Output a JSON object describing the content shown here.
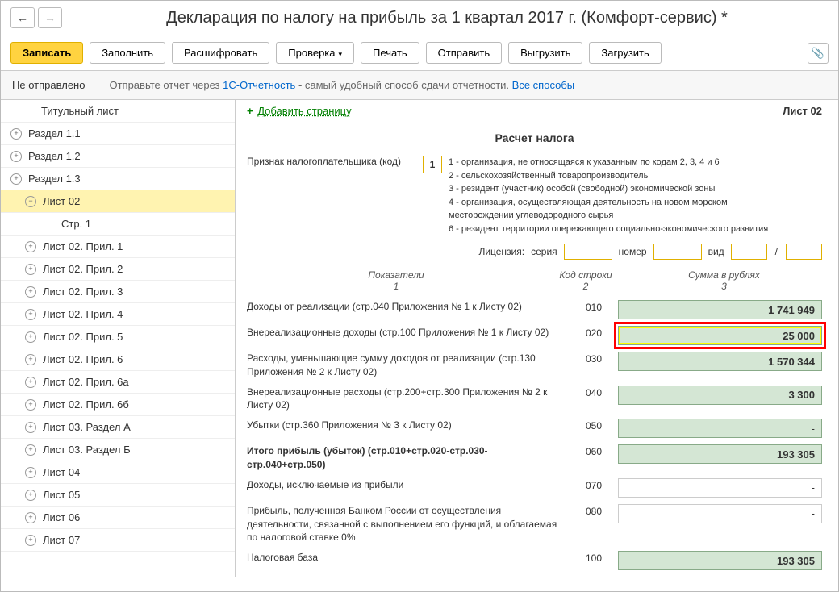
{
  "title": "Декларация по налогу на прибыль за 1 квартал 2017 г. (Комфорт-сервис) *",
  "toolbar": {
    "save": "Записать",
    "fill": "Заполнить",
    "decode": "Расшифровать",
    "check": "Проверка",
    "print": "Печать",
    "send": "Отправить",
    "export": "Выгрузить",
    "import": "Загрузить"
  },
  "info": {
    "status": "Не отправлено",
    "text1": "Отправьте отчет через ",
    "link1": "1С-Отчетность",
    "text2": " - самый удобный способ сдачи отчетности. ",
    "link2": "Все способы"
  },
  "tree": [
    {
      "label": "Титульный лист",
      "level": 2,
      "exp": null
    },
    {
      "label": "Раздел 1.1",
      "level": 1,
      "exp": "plus"
    },
    {
      "label": "Раздел 1.2",
      "level": 1,
      "exp": "plus"
    },
    {
      "label": "Раздел 1.3",
      "level": 1,
      "exp": "plus"
    },
    {
      "label": "Лист 02",
      "level": 2,
      "exp": "minus",
      "selected": true
    },
    {
      "label": "Стр. 1",
      "level": 3,
      "exp": null
    },
    {
      "label": "Лист 02. Прил. 1",
      "level": 2,
      "exp": "plus"
    },
    {
      "label": "Лист 02. Прил. 2",
      "level": 2,
      "exp": "plus"
    },
    {
      "label": "Лист 02. Прил. 3",
      "level": 2,
      "exp": "plus"
    },
    {
      "label": "Лист 02. Прил. 4",
      "level": 2,
      "exp": "plus"
    },
    {
      "label": "Лист 02. Прил. 5",
      "level": 2,
      "exp": "plus"
    },
    {
      "label": "Лист 02. Прил. 6",
      "level": 2,
      "exp": "plus"
    },
    {
      "label": "Лист 02. Прил. 6а",
      "level": 2,
      "exp": "plus"
    },
    {
      "label": "Лист 02. Прил. 6б",
      "level": 2,
      "exp": "plus"
    },
    {
      "label": "Лист 03. Раздел А",
      "level": 2,
      "exp": "plus"
    },
    {
      "label": "Лист 03. Раздел Б",
      "level": 2,
      "exp": "plus"
    },
    {
      "label": "Лист 04",
      "level": 2,
      "exp": "plus"
    },
    {
      "label": "Лист 05",
      "level": 2,
      "exp": "plus"
    },
    {
      "label": "Лист 06",
      "level": 2,
      "exp": "plus"
    },
    {
      "label": "Лист 07",
      "level": 2,
      "exp": "plus"
    }
  ],
  "content": {
    "add_page": "Добавить страницу",
    "sheet": "Лист 02",
    "heading": "Расчет налога",
    "taxpayer_label": "Признак налогоплательщика (код)",
    "taxpayer_code": "1",
    "codes": "1 - организация, не относящаяся к указанным по кодам 2, 3, 4 и 6\n2 - сельскохозяйственный товаропроизводитель\n3 - резидент (участник) особой (свободной) экономической зоны\n4 - организация, осуществляющая деятельность на новом морском месторождении углеводородного сырья\n6 - резидент территории опережающего социально-экономического развития",
    "license": {
      "lbl": "Лицензия:",
      "ser": "серия",
      "num": "номер",
      "vid": "вид"
    },
    "cols": {
      "c1": "Показатели\n1",
      "c2": "Код строки\n2",
      "c3": "Сумма в рублях\n3"
    },
    "rows": [
      {
        "desc": "Доходы от реализации (стр.040 Приложения № 1 к Листу 02)",
        "code": "010",
        "val": "1 741 949",
        "green": true,
        "hl": false
      },
      {
        "desc": "Внереализационные доходы (стр.100 Приложения № 1 к Листу 02)",
        "code": "020",
        "val": "25 000",
        "green": true,
        "hl": true
      },
      {
        "desc": "Расходы, уменьшающие сумму доходов от реализации (стр.130 Приложения № 2 к Листу 02)",
        "code": "030",
        "val": "1 570 344",
        "green": true,
        "hl": false
      },
      {
        "desc": "Внереализационные расходы (стр.200+стр.300 Приложения № 2 к Листу 02)",
        "code": "040",
        "val": "3 300",
        "green": true,
        "hl": false
      },
      {
        "desc": "Убытки (стр.360 Приложения № 3 к Листу 02)",
        "code": "050",
        "val": "",
        "green": true,
        "hl": false,
        "dash": true
      },
      {
        "desc": "Итого прибыль (убыток)   (стр.010+стр.020-стр.030-стр.040+стр.050)",
        "code": "060",
        "val": "193 305",
        "green": true,
        "hl": false,
        "bold": true
      },
      {
        "desc": "Доходы, исключаемые из прибыли",
        "code": "070",
        "val": "",
        "green": false,
        "hl": false,
        "dash": true
      },
      {
        "desc": "Прибыль, полученная Банком России от осуществления деятельности, связанной с выполнением его функций, и облагаемая по налоговой ставке 0%",
        "code": "080",
        "val": "",
        "green": false,
        "hl": false,
        "dash": true
      },
      {
        "desc": "Налоговая база",
        "code": "100",
        "val": "193 305",
        "green": true,
        "hl": false
      }
    ]
  }
}
